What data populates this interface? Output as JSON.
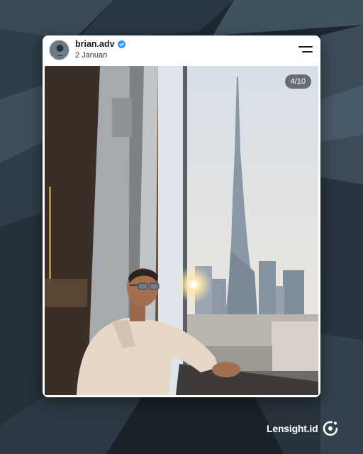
{
  "post": {
    "username": "brian.adv",
    "date": "2 Januari",
    "image_counter": "4/10",
    "verified": true
  },
  "watermark": {
    "brand": "Lensight.id"
  },
  "icons": {
    "verified": "verified-badge-icon",
    "menu": "menu-icon",
    "brand": "lensight-logo-icon"
  },
  "colors": {
    "verified": "#3897f0",
    "background": "#1f2a33",
    "card": "#ffffff"
  }
}
